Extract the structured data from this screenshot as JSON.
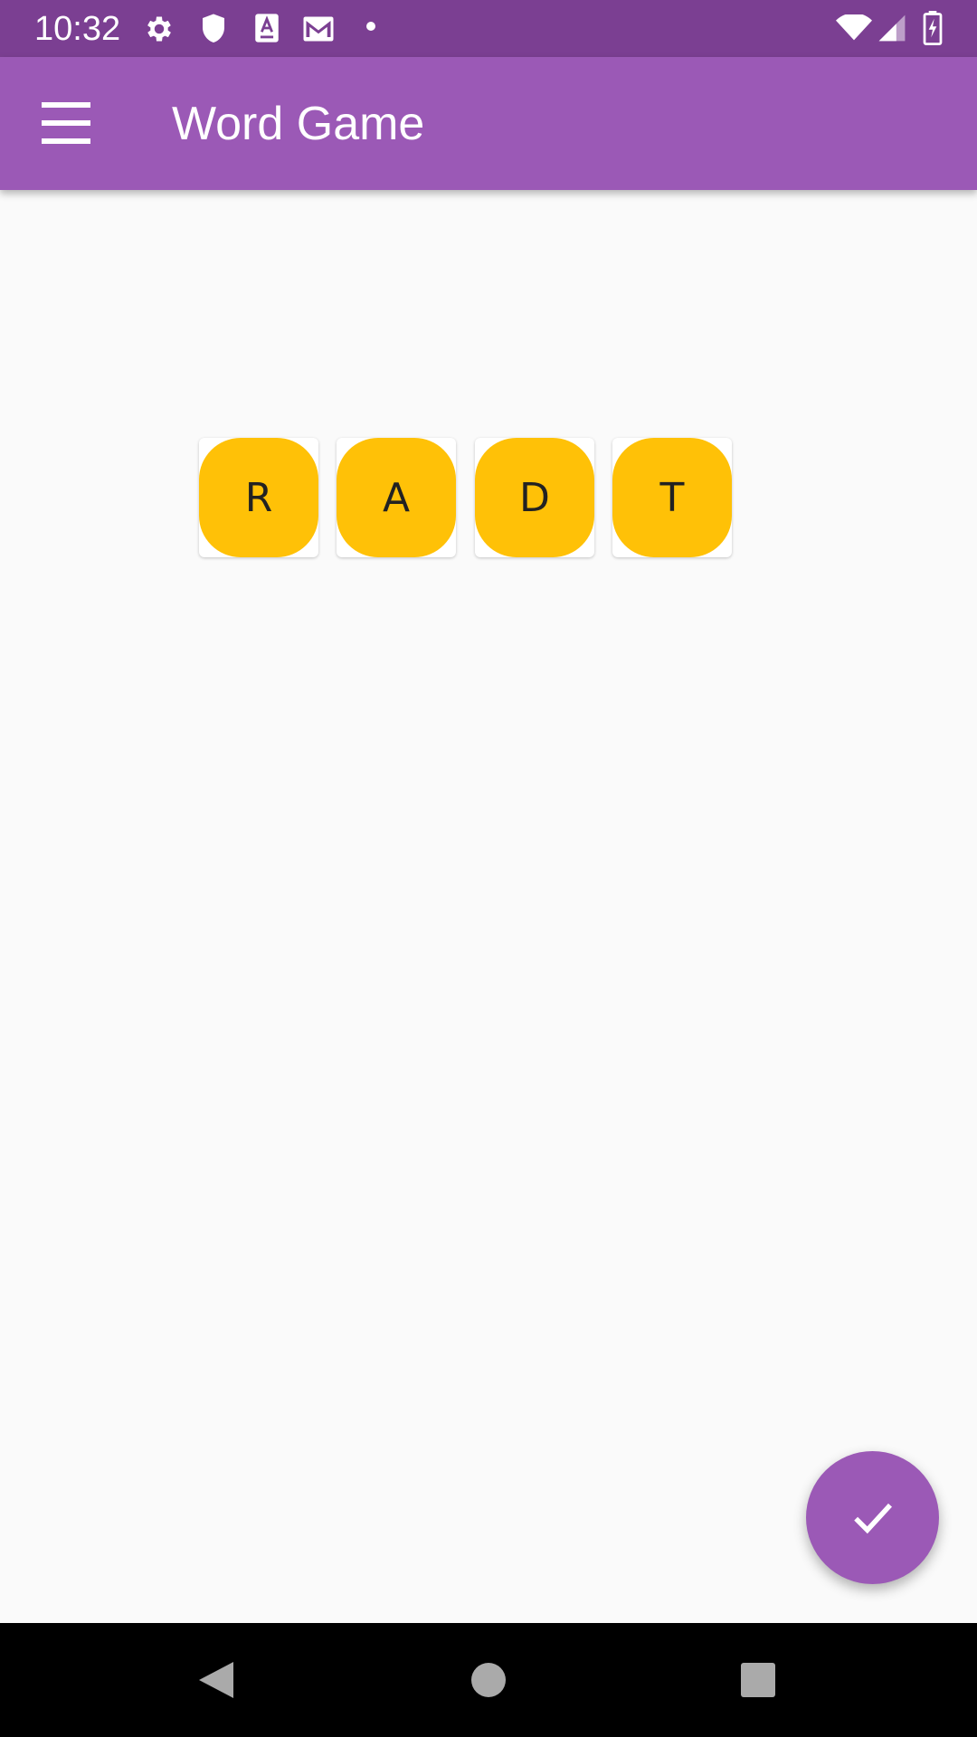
{
  "status_bar": {
    "time": "10:32",
    "left_icons": [
      "gear-icon",
      "shield-icon",
      "text-a-icon",
      "gmail-icon",
      "dot-icon"
    ],
    "right_icons": [
      "wifi-icon",
      "signal-icon",
      "battery-charging-icon"
    ]
  },
  "app_bar": {
    "title": "Word Game",
    "menu_icon": "hamburger-menu-icon"
  },
  "tiles": [
    {
      "letter": "R"
    },
    {
      "letter": "A"
    },
    {
      "letter": "D"
    },
    {
      "letter": "T"
    }
  ],
  "fab": {
    "icon": "check-icon"
  },
  "nav_bar": {
    "buttons": [
      "back-icon",
      "home-icon",
      "recents-icon"
    ]
  },
  "colors": {
    "status_bar": "#7b3f92",
    "app_bar": "#9b59b6",
    "tile": "#ffc107",
    "background": "#fafafa",
    "nav_bar": "#000000"
  }
}
